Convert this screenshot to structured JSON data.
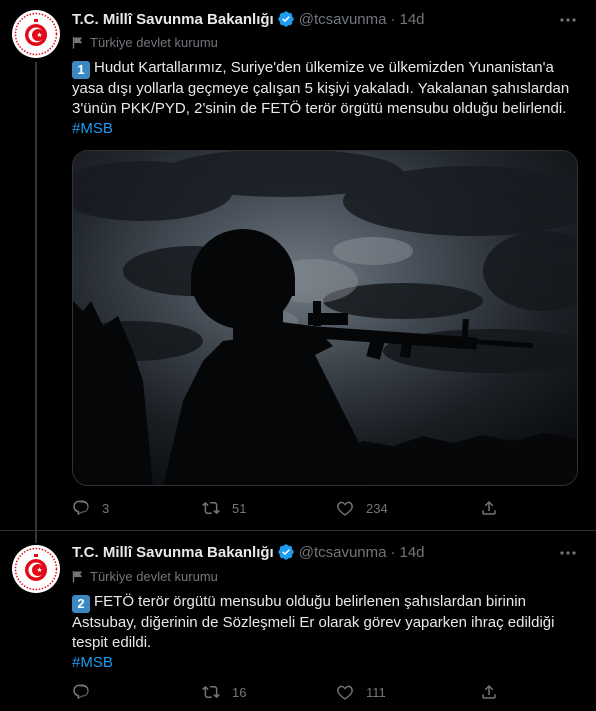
{
  "tweets": [
    {
      "author": "T.C. Millî Savunma Bakanlığı",
      "handle": "@tcsavunma",
      "time": "14d",
      "label": "Türkiye devlet kurumu",
      "number": "1",
      "text": "Hudut Kartallarımız, Suriye'den ülkemize ve ülkemizden Yunanistan'a yasa dışı yollarla geçmeye çalışan 5 kişiyi yakaladı. Yakalanan şahıslardan 3'ünün PKK/PYD, 2'sinin de FETÖ terör örgütü mensubu olduğu belirlendi.",
      "hashtag": "#MSB",
      "replies": "3",
      "retweets": "51",
      "likes": "234"
    },
    {
      "author": "T.C. Millî Savunma Bakanlığı",
      "handle": "@tcsavunma",
      "time": "14d",
      "label": "Türkiye devlet kurumu",
      "number": "2",
      "text": "FETÖ terör örgütü mensubu olduğu belirlenen şahıslardan birinin Astsubay, diğerinin de Sözleşmeli Er olarak görev yaparken ihraç edildiği tespit edildi.",
      "hashtag": "#MSB",
      "replies": "",
      "retweets": "16",
      "likes": "111"
    }
  ],
  "colors": {
    "background": "#000000",
    "text": "#e7e9ea",
    "muted": "#71767b",
    "link": "#1d9bf0",
    "verified": "#1d9bf0",
    "emblem_red": "#e30a17"
  },
  "icons": [
    "ministry-emblem-icon",
    "verified-badge-icon",
    "more-icon",
    "government-flag-icon",
    "reply-icon",
    "retweet-icon",
    "like-icon",
    "share-icon"
  ]
}
